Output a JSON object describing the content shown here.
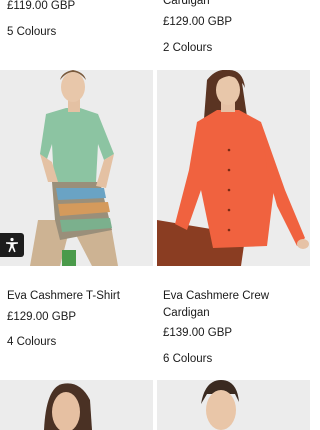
{
  "products": [
    {
      "name": "",
      "price": "£119.00 GBP",
      "colours": "5 Colours",
      "image": "product-photo-top-left"
    },
    {
      "name": "Cardigan",
      "price": "£129.00 GBP",
      "colours": "2 Colours",
      "image": "product-photo-top-right"
    },
    {
      "name": "Eva Cashmere T-Shirt",
      "price": "£129.00 GBP",
      "colours": "4 Colours",
      "image": "model-green-cashmere-tshirt"
    },
    {
      "name_line1": "Eva Cashmere Crew",
      "name_line2": "Cardigan",
      "price": "£139.00 GBP",
      "colours": "6 Colours",
      "image": "model-orange-cashmere-cardigan"
    },
    {
      "image": "model-portrait-bottom-left"
    },
    {
      "image": "model-portrait-bottom-right"
    }
  ],
  "accessibility": {
    "icon": "accessibility-icon",
    "color": "#1d1d1d"
  },
  "colors": {
    "green_top": "#8cc4a2",
    "orange_cardigan": "#f0623f",
    "background_tile": "#ebebeb"
  }
}
